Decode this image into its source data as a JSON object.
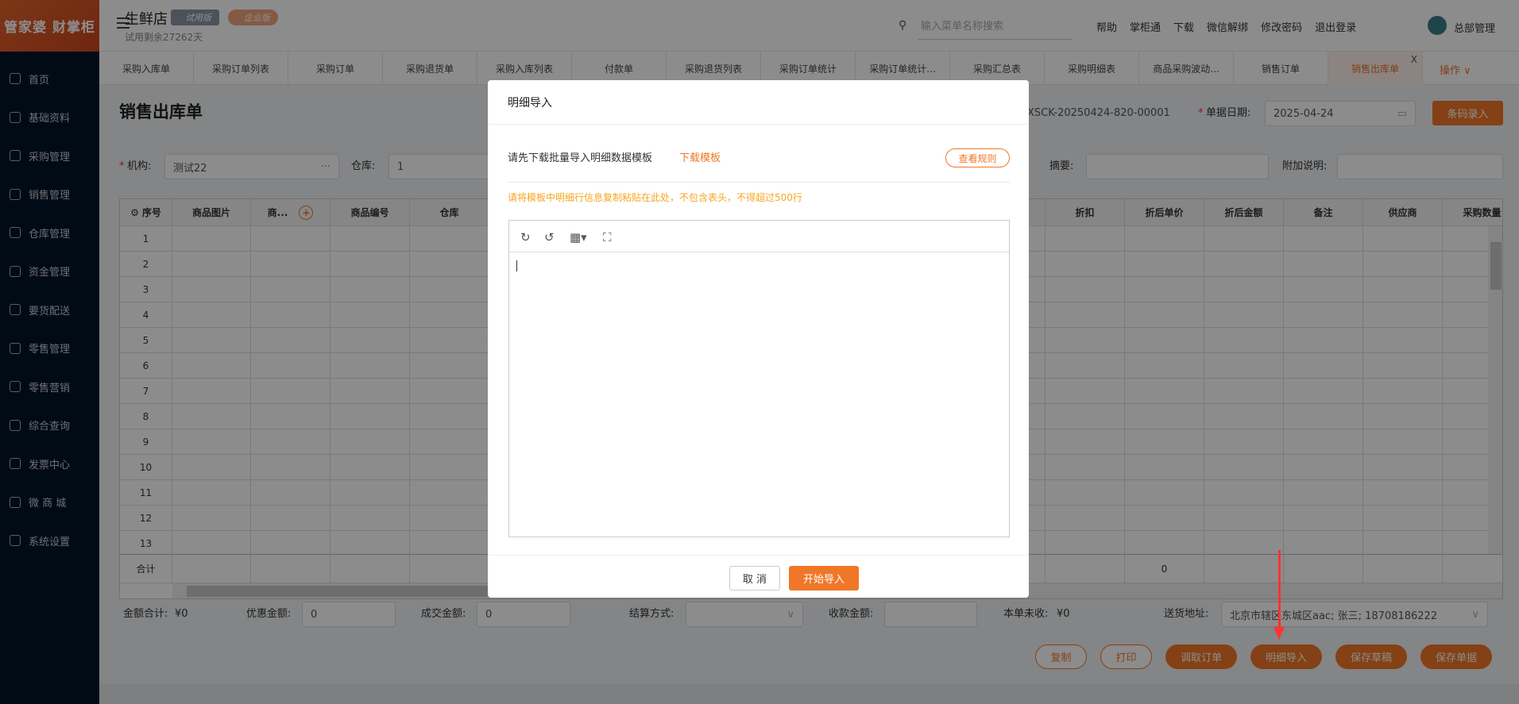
{
  "logo": "管家婆 财掌柜",
  "sidebar": {
    "items": [
      "首页",
      "基础资料",
      "采购管理",
      "销售管理",
      "仓库管理",
      "资金管理",
      "要货配送",
      "零售管理",
      "零售营销",
      "综合查询",
      "发票中心",
      "微 商 城",
      "系统设置"
    ]
  },
  "header": {
    "store": "生鲜店",
    "badge_trial": "试用版",
    "badge_enterprise": "企业版",
    "trial_remaining": "试用剩余27262天",
    "search_placeholder": "输入菜单名称搜索",
    "links": [
      "帮助",
      "掌柜通",
      "下载",
      "微信解绑",
      "修改密码",
      "退出登录"
    ],
    "user": "总部管理"
  },
  "tabs": [
    "采购入库单",
    "采购订单列表",
    "采购订单",
    "采购退货单",
    "采购入库列表",
    "付款单",
    "采购退货列表",
    "采购订单统计",
    "采购订单统计...",
    "采购汇总表",
    "采购明细表",
    "商品采购波动...",
    "销售订单",
    "销售出库单"
  ],
  "active_tab": 13,
  "tab_close": "X",
  "operations": "操作 ∨",
  "page": {
    "title": "销售出库单",
    "doc_no": "XSCK-20250424-820-00001",
    "date_label": "单据日期:",
    "date": "2025-04-24",
    "barcode_btn": "条码录入",
    "org_label": "机构:",
    "org_value": "测试22",
    "org_more": "···",
    "wh_label": "仓库:",
    "wh_value": "1",
    "summary_label": "摘要:",
    "extra_label": "附加说明:",
    "req": "*"
  },
  "table": {
    "left_columns": [
      "序号",
      "商品图片",
      "商...",
      "商品编号",
      "仓库"
    ],
    "right_columns": [
      "折扣",
      "折后单价",
      "折后金额",
      "备注",
      "供应商",
      "采购数量"
    ],
    "rows": [
      "1",
      "2",
      "3",
      "4",
      "5",
      "6",
      "7",
      "8",
      "9",
      "10",
      "11",
      "12",
      "13"
    ],
    "total_label": "合计",
    "total_amount": "0"
  },
  "footer": {
    "sum_label": "金额合计:",
    "sum_value": "¥0",
    "discount_label": "优惠金额:",
    "discount_value": "0",
    "deal_label": "成交金额:",
    "deal_value": "0",
    "settle_label": "结算方式:",
    "receive_label": "收款金额:",
    "unpaid_label": "本单未收:",
    "unpaid_value": "¥0",
    "address_label": "送货地址:",
    "address_value": "北京市辖区东城区aac; 张三; 18708186222",
    "buttons": [
      "复制",
      "打印",
      "调取订单",
      "明细导入",
      "保存草稿",
      "保存单据"
    ]
  },
  "dialog": {
    "title": "明细导入",
    "instruction": "请先下载批量导入明细数据模板",
    "download": "下载模板",
    "rules_btn": "查看规则",
    "note": "请将模板中明细行信息复制粘贴在此处，不包含表头，不得超过500行",
    "cancel": "取 消",
    "start": "开始导入"
  },
  "colors": {
    "accent": "#f07727",
    "sidebar": "#001529",
    "note": "#f5a623"
  }
}
